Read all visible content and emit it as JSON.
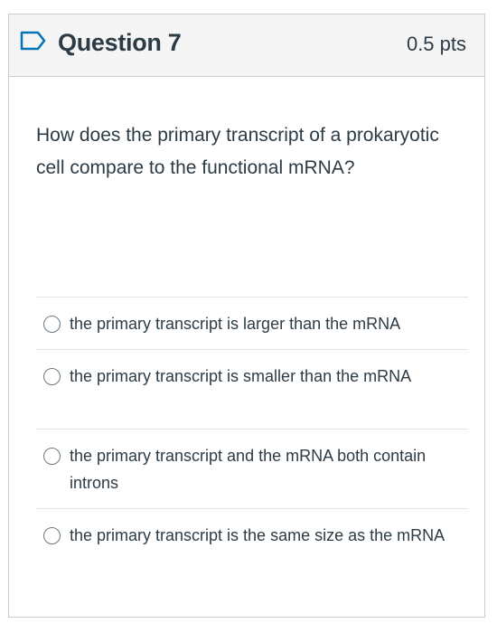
{
  "question": {
    "title": "Question 7",
    "points": "0.5 pts",
    "flag_icon": "flag-bookmark-icon",
    "text": "How does the primary transcript of a prokaryotic cell compare to the functional mRNA?"
  },
  "answers": [
    {
      "label": "the primary transcript is larger than the mRNA",
      "selected": false
    },
    {
      "label": "the primary transcript is smaller than the mRNA",
      "selected": false
    },
    {
      "label": "the primary transcript and the mRNA both contain introns",
      "selected": false
    },
    {
      "label": "the primary transcript is the same size as the mRNA",
      "selected": false
    }
  ],
  "colors": {
    "text": "#2d3b45",
    "header_bg": "#f5f5f5",
    "border": "#c7cdd1",
    "flag": "#0374b5"
  }
}
